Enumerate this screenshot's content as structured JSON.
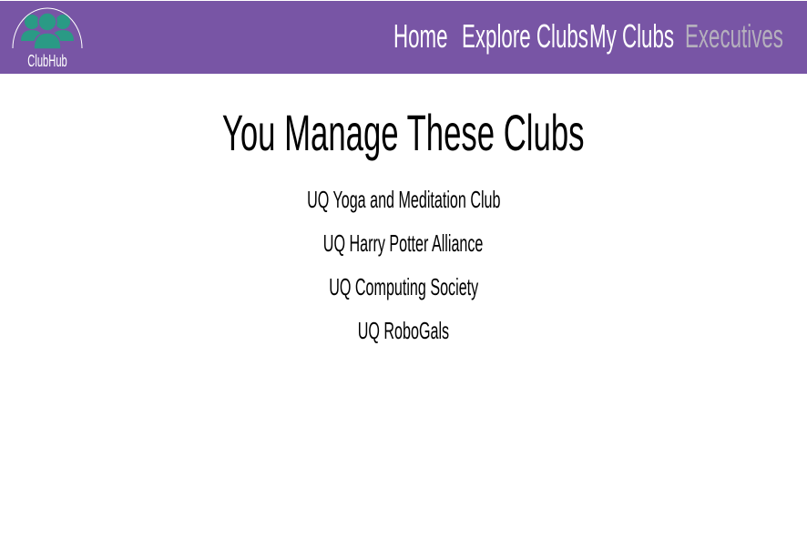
{
  "brand": {
    "name": "ClubHub",
    "colors": {
      "header": "#7855a5",
      "logo": "#2a9a85",
      "active_nav": "#b5b0bd"
    }
  },
  "nav": [
    {
      "label": "Home"
    },
    {
      "label": "Explore Clubs"
    },
    {
      "label": "My Clubs"
    },
    {
      "label": "Executives",
      "active": true
    }
  ],
  "main": {
    "title": "You Manage These Clubs",
    "clubs": [
      "UQ Yoga and Meditation Club",
      "UQ Harry Potter Alliance",
      "UQ Computing Society",
      "UQ RoboGals"
    ]
  }
}
